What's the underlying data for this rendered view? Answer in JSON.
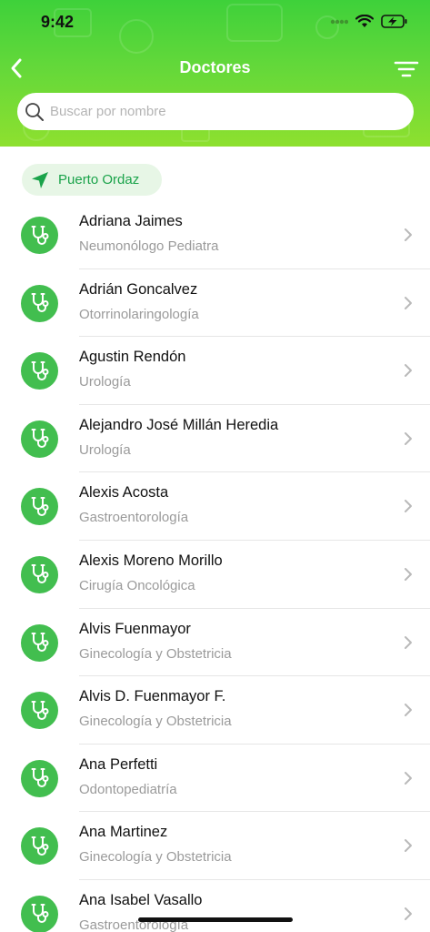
{
  "status_bar": {
    "time": "9:42"
  },
  "nav": {
    "title": "Doctores"
  },
  "search": {
    "placeholder": "Buscar por nombre",
    "value": ""
  },
  "location": {
    "label": "Puerto Ordaz"
  },
  "doctors": [
    {
      "name": "Adriana Jaimes",
      "specialty": "Neumonólogo Pediatra"
    },
    {
      "name": "Adrián Goncalvez",
      "specialty": "Otorrinolaringología"
    },
    {
      "name": "Agustin Rendón",
      "specialty": "Urología"
    },
    {
      "name": "Alejandro José Millán Heredia",
      "specialty": "Urología"
    },
    {
      "name": "Alexis Acosta",
      "specialty": "Gastroentorología"
    },
    {
      "name": "Alexis Moreno Morillo",
      "specialty": "Cirugía Oncológica"
    },
    {
      "name": "Alvis Fuenmayor",
      "specialty": "Ginecología y Obstetricia"
    },
    {
      "name": "Alvis D. Fuenmayor F.",
      "specialty": "Ginecología y Obstetricia"
    },
    {
      "name": "Ana Perfetti",
      "specialty": "Odontopediatría"
    },
    {
      "name": "Ana Martinez",
      "specialty": "Ginecología y Obstetricia"
    },
    {
      "name": "Ana Isabel Vasallo",
      "specialty": "Gastroentorología"
    }
  ],
  "colors": {
    "accent": "#42be4f",
    "header_top": "#3ed13a",
    "header_bottom": "#8ee02f",
    "chip_text": "#1aa34a"
  },
  "icons": {
    "avatar": "stethoscope-icon",
    "row_action": "chevron-right-icon",
    "back": "chevron-left-icon",
    "filter": "filter-icon",
    "location": "navigation-arrow-icon",
    "search": "search-icon"
  }
}
